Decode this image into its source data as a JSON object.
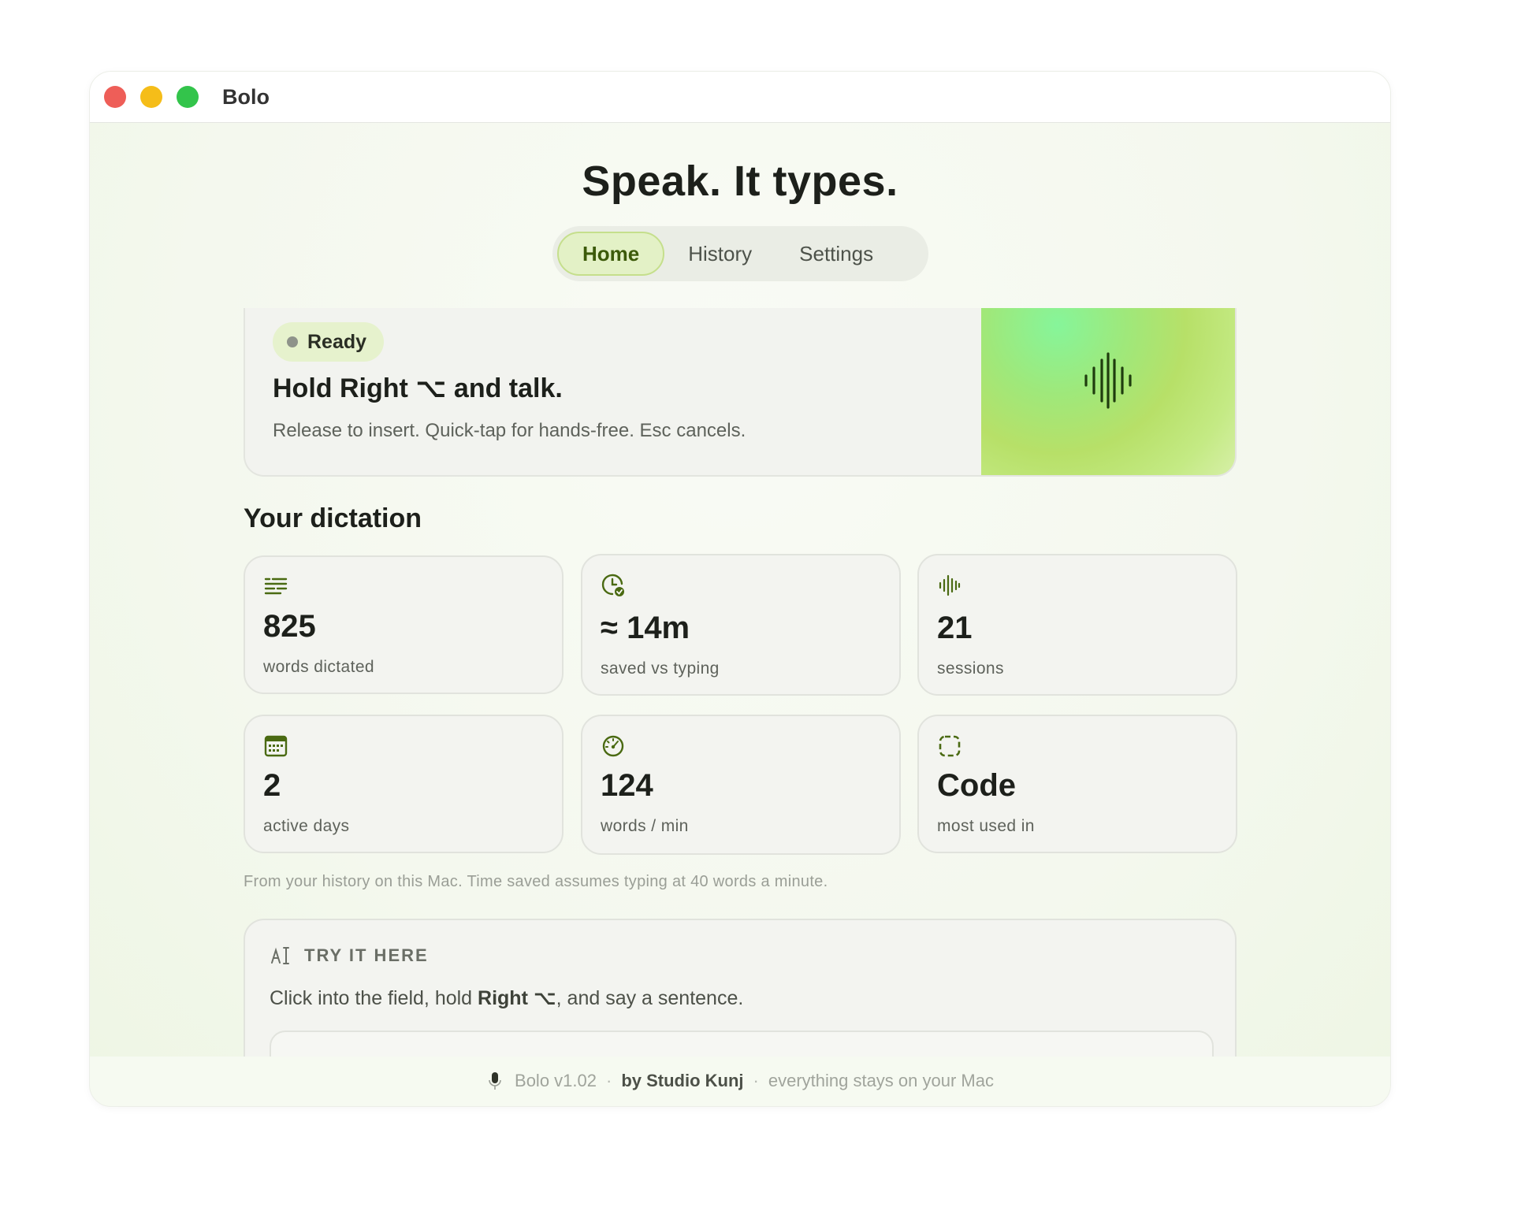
{
  "window": {
    "title": "Bolo"
  },
  "hero": {
    "title": "Speak. It types."
  },
  "tabs": [
    {
      "label": "Home",
      "active": true
    },
    {
      "label": "History",
      "active": false
    },
    {
      "label": "Settings",
      "active": false
    }
  ],
  "status": {
    "badge": "Ready",
    "title": "Hold Right ⌥ and talk.",
    "subtitle": "Release to insert. Quick-tap for hands-free. Esc cancels."
  },
  "dictation": {
    "title": "Your dictation",
    "stats": [
      {
        "icon": "text-lines-icon",
        "value": "825",
        "label": "words dictated"
      },
      {
        "icon": "clock-check-icon",
        "value": "≈ 14m",
        "label": "saved vs typing"
      },
      {
        "icon": "waveform-icon",
        "value": "21",
        "label": "sessions"
      },
      {
        "icon": "calendar-icon",
        "value": "2",
        "label": "active days"
      },
      {
        "icon": "speedometer-icon",
        "value": "124",
        "label": "words / min"
      },
      {
        "icon": "dashed-square-icon",
        "value": "Code",
        "label": "most used in"
      }
    ],
    "footnote": "From your history on this Mac. Time saved assumes typing at 40 words a minute."
  },
  "try": {
    "heading": "TRY IT HERE",
    "text_before": "Click into the field, hold ",
    "text_bold": "Right ⌥",
    "text_after": ", and say a sentence."
  },
  "footer": {
    "version": "Bolo v1.02",
    "by": "by Studio Kunj",
    "note": "everything stays on your Mac"
  },
  "colors": {
    "accent": "#4a6a12",
    "tab_active_bg": "#e3f1c6",
    "badge_bg": "#e6f2cd",
    "wave_green": "#1f3d0e"
  }
}
